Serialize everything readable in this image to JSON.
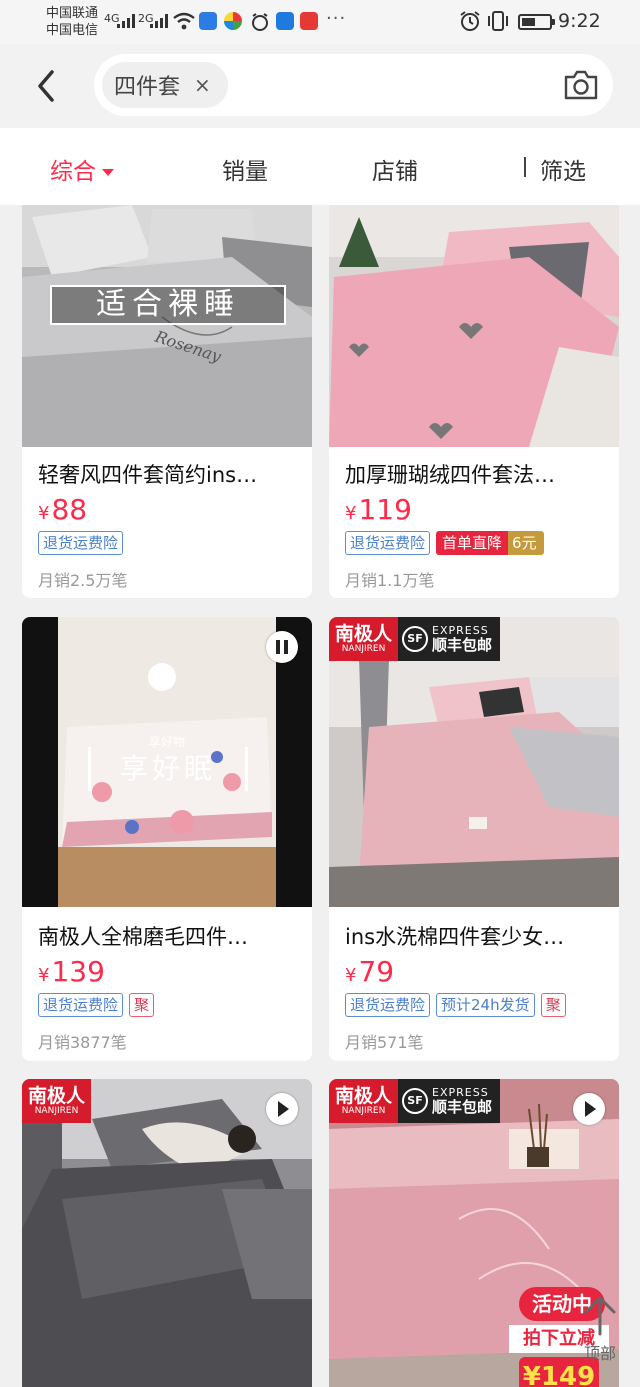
{
  "status_bar": {
    "carrier_1": "中国联通",
    "carrier_2": "中国电信",
    "network_1": "4G",
    "network_2": "2G",
    "time": "9:22",
    "battery_level": 0.5
  },
  "search": {
    "keyword": "四件套",
    "clear_symbol": "×"
  },
  "sort_bar": {
    "items": [
      "综合",
      "销量",
      "店铺",
      "筛选"
    ],
    "active_index": 0
  },
  "products": [
    {
      "title": "轻奢风四件套简约ins…",
      "currency": "¥",
      "price": "88",
      "tags": [
        "退货运费险"
      ],
      "sales": "月销2.5万笔",
      "image_caption": "适合裸睡",
      "image_script": "Rosenay"
    },
    {
      "title": "加厚珊瑚绒四件套法…",
      "currency": "¥",
      "price": "119",
      "tags": [
        "退货运费险"
      ],
      "promo_label": "首单直降",
      "promo_value": "6元",
      "sales": "月销1.1万笔"
    },
    {
      "title": "南极人全棉磨毛四件…",
      "currency": "¥",
      "price": "139",
      "tags": [
        "退货运费险",
        "聚"
      ],
      "sales": "月销3877笔",
      "image_caption_small": "享好物",
      "image_caption": "享好眠",
      "video_state": "playing"
    },
    {
      "title": "ins水洗棉四件套少女…",
      "currency": "¥",
      "price": "79",
      "tags": [
        "退货运费险",
        "预计24h发货",
        "聚"
      ],
      "sales": "月销571笔",
      "brand_cn": "南极人",
      "brand_en": "NANJIREN",
      "shipping_en": "EXPRESS",
      "shipping_cn": "顺丰包邮",
      "sf_logo": "SF"
    },
    {
      "brand_cn": "南极人",
      "brand_en": "NANJIREN",
      "video_state": "paused"
    },
    {
      "brand_cn": "南极人",
      "brand_en": "NANJIREN",
      "shipping_en": "EXPRESS",
      "shipping_cn": "顺丰包邮",
      "sf_logo": "SF",
      "activity_line1": "活动中",
      "activity_line2": "拍下立减",
      "activity_price": "¥149",
      "video_state": "paused"
    }
  ],
  "back_to_top": {
    "label": "顶部"
  },
  "colors": {
    "accent": "#ff2a4a",
    "tag_blue": "#4a7fd0",
    "promo_red": "#e8253e",
    "promo_gold": "#c59a3a",
    "brand_red": "#d61c2c"
  }
}
